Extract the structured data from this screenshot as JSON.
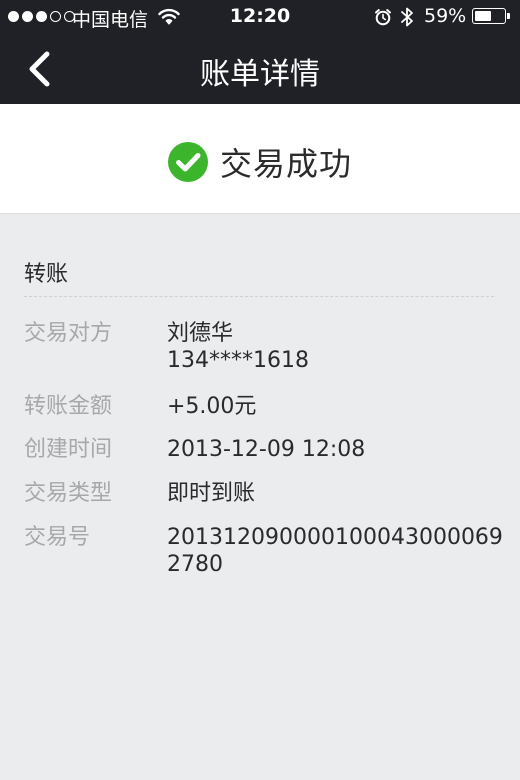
{
  "status_bar": {
    "carrier": "中国电信",
    "time": "12:20",
    "battery_percent": "59%",
    "battery_level": 0.59,
    "signal_strength": 3,
    "signal_max": 5
  },
  "nav": {
    "back_icon": "chevron-left-icon",
    "title": "账单详情"
  },
  "result": {
    "icon": "check-circle-icon",
    "icon_color": "#3cb52c",
    "text": "交易成功"
  },
  "detail": {
    "heading": "转账",
    "rows": [
      {
        "label": "交易对方",
        "value_line1": "刘德华",
        "value_line2": "134****1618"
      },
      {
        "label": "转账金额",
        "value_line1": "+5.00元"
      },
      {
        "label": "创建时间",
        "value_line1": "2013-12-09 12:08"
      },
      {
        "label": "交易类型",
        "value_line1": "即时到账"
      },
      {
        "label": "交易号",
        "value_line1": "201312090000100043000069",
        "value_line2": "2780"
      }
    ]
  },
  "colors": {
    "nav_background": "#1f2126",
    "page_background": "#ebecee",
    "label_text": "#a7a8ab",
    "value_text": "#2a2a2a"
  }
}
